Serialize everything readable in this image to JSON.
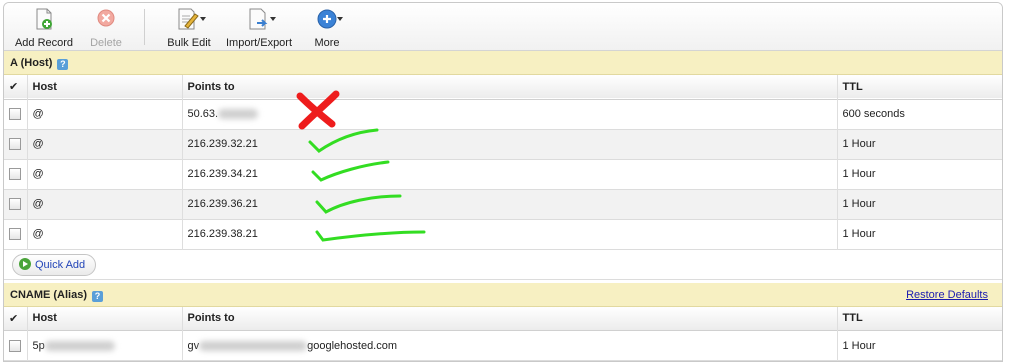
{
  "toolbar": {
    "add_record": "Add Record",
    "delete": "Delete",
    "bulk_edit": "Bulk Edit",
    "import_export": "Import/Export",
    "more": "More"
  },
  "a_section": {
    "title": "A (Host)",
    "help": "?",
    "columns": {
      "check": "✔",
      "host": "Host",
      "points_to": "Points to",
      "ttl": "TTL"
    },
    "rows": [
      {
        "host": "@",
        "points_to": "50.63.",
        "ttl": "600 seconds"
      },
      {
        "host": "@",
        "points_to": "216.239.32.21",
        "ttl": "1 Hour"
      },
      {
        "host": "@",
        "points_to": "216.239.34.21",
        "ttl": "1 Hour"
      },
      {
        "host": "@",
        "points_to": "216.239.36.21",
        "ttl": "1 Hour"
      },
      {
        "host": "@",
        "points_to": "216.239.38.21",
        "ttl": "1 Hour"
      }
    ],
    "quick_add": "Quick Add"
  },
  "cname_section": {
    "title": "CNAME (Alias)",
    "help": "?",
    "restore_defaults": "Restore Defaults",
    "columns": {
      "check": "✔",
      "host": "Host",
      "points_to": "Points to",
      "ttl": "TTL"
    },
    "rows": [
      {
        "host": "5p",
        "points_to_prefix": "gv",
        "points_to_suffix": "googlehosted.com",
        "ttl": "1 Hour"
      }
    ]
  },
  "annotations": {
    "wrong_mark": "red-x-mark-icon",
    "ok_mark": "green-check-mark-icon",
    "red": "#ee1c1c",
    "green": "#33dd22"
  }
}
